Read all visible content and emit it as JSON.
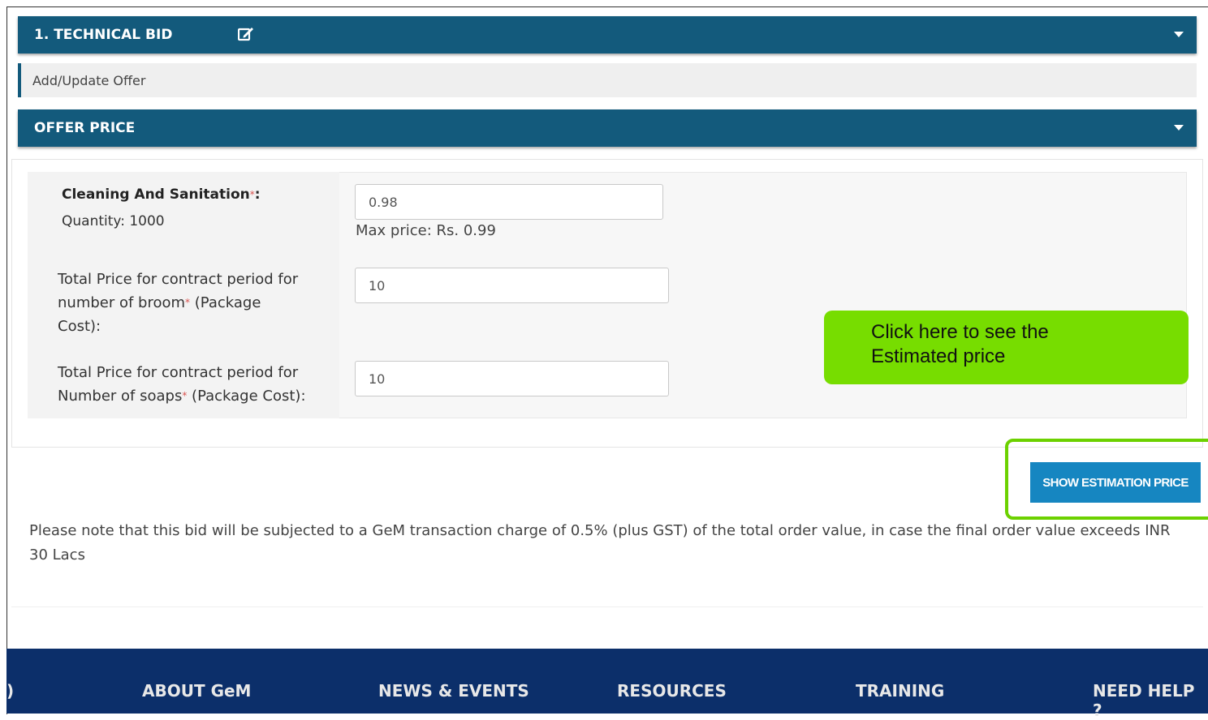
{
  "technical_bid": {
    "title": "1. TECHNICAL BID"
  },
  "subheader": {
    "label": "Add/Update Offer"
  },
  "offer_price": {
    "title": "OFFER PRICE"
  },
  "items": [
    {
      "name": "Cleaning And Sanitation",
      "suffix": ":",
      "quantity": "Quantity: 1000",
      "value": "0.98",
      "hint": "Max price: Rs. 0.99"
    },
    {
      "line1": "Total Price for contract period for",
      "line2": "number of broom",
      "line2_suffix": " (Package",
      "line3": "Cost):",
      "value": "10"
    },
    {
      "line1": "Total Price for contract period for",
      "line2": "Number of soaps",
      "line2_suffix": " (Package Cost):",
      "value": "10"
    }
  ],
  "required_marker": "*",
  "callout": {
    "line1": "Click here to see the",
    "line2": "Estimated price"
  },
  "estimation_button": {
    "label": "SHOW ESTIMATION PRICE"
  },
  "note": "Please note that this bid will be subjected to a GeM transaction charge of 0.5% (plus GST) of the total order value, in case the final order value exceeds INR 30 Lacs",
  "footer": {
    "cut_text": ")",
    "nav": [
      "ABOUT GeM",
      "NEWS & EVENTS",
      "RESOURCES",
      "TRAINING",
      "NEED HELP ?"
    ]
  },
  "colors": {
    "header_bar": "#135a7c",
    "button": "#1686c1",
    "callout": "#77dd00",
    "footer": "#0c2f6a"
  },
  "icons": [
    "edit-icon",
    "caret-down-icon"
  ]
}
